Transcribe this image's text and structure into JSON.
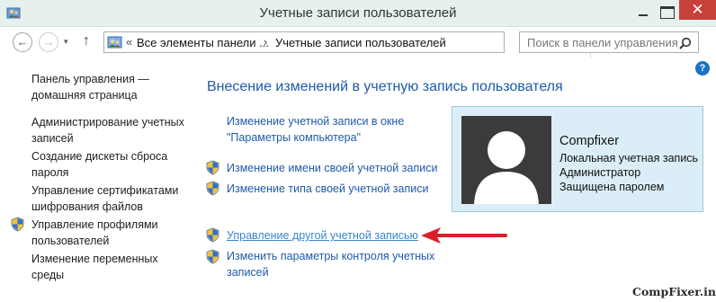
{
  "window": {
    "title": "Учетные записи пользователей",
    "close_glyph": "✕"
  },
  "nav": {
    "back_glyph": "←",
    "forward_glyph": "→",
    "up_glyph": "↑",
    "breadcrumb_prefix": "«",
    "breadcrumb_parent": "Все элементы панели ...",
    "breadcrumb_sep": "›",
    "breadcrumb_current": "Учетные записи пользователей",
    "refresh_glyph": "↻",
    "search_placeholder": "Поиск в панели управления"
  },
  "help": "?",
  "sidebar": {
    "home_line1": "Панель управления —",
    "home_line2": "домашняя страница",
    "items": [
      {
        "line1": "Администрирование учетных",
        "line2": "записей",
        "shield": false
      },
      {
        "line1": "Создание дискеты сброса",
        "line2": "пароля",
        "shield": false
      },
      {
        "line1": "Управление сертификатами",
        "line2": "шифрования файлов",
        "shield": false
      },
      {
        "line1": "Управление профилями",
        "line2": "пользователей",
        "shield": true
      },
      {
        "line1": "Изменение переменных",
        "line2": "среды",
        "shield": false
      }
    ]
  },
  "main": {
    "title": "Внесение изменений в учетную запись пользователя",
    "links": [
      {
        "line1": "Изменение учетной записи в окне",
        "line2": "\"Параметры компьютера\"",
        "shield": false
      },
      {
        "line1": "Изменение имени своей учетной записи",
        "line2": "",
        "shield": true
      },
      {
        "line1": "Изменение типа своей учетной записи",
        "line2": "",
        "shield": true
      },
      {
        "line1": "Управление другой учетной записью",
        "line2": "",
        "shield": true,
        "hover": true
      },
      {
        "line1": "Изменить параметры контроля учетных",
        "line2": "записей",
        "shield": true
      }
    ]
  },
  "user": {
    "name": "Compfixer",
    "details": [
      "Локальная учетная запись",
      "Администратор",
      "Защищена паролем"
    ]
  },
  "watermark": "CompFixer.info",
  "colors": {
    "link": "#1e5aa8",
    "title_bar": "#e6f1ee",
    "close": "#c7413b",
    "card_bg": "#dbeef7",
    "arrow": "#d9202a"
  }
}
